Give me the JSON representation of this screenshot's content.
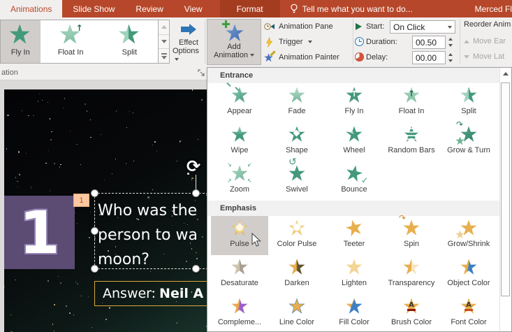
{
  "titlebar": {
    "tabs": [
      {
        "label": "Animations",
        "state": "active"
      },
      {
        "label": "Slide Show",
        "state": "normal"
      },
      {
        "label": "Review",
        "state": "normal"
      },
      {
        "label": "View",
        "state": "normal"
      },
      {
        "label": "Format",
        "state": "contextual"
      }
    ],
    "tell_me": "Tell me what you want to do...",
    "account": "Merced Fl"
  },
  "ribbon": {
    "group_label": "ation",
    "gallery_items": [
      {
        "label": "Fly In",
        "icon": "star-flyin",
        "selected": true
      },
      {
        "label": "Float In",
        "icon": "star-floatin",
        "selected": false
      },
      {
        "label": "Split",
        "icon": "star-split",
        "selected": false
      }
    ],
    "effect_options": {
      "line1": "Effect",
      "line2": "Options"
    },
    "add_animation": {
      "line1": "Add",
      "line2": "Animation"
    },
    "advanced": {
      "pane": "Animation Pane",
      "trigger": "Trigger",
      "painter": "Animation Painter"
    },
    "timing": {
      "start_label": "Start:",
      "start_value": "On Click",
      "duration_label": "Duration:",
      "duration_value": "00.50",
      "delay_label": "Delay:",
      "delay_value": "00.00"
    },
    "reorder": {
      "title": "Reorder Anim",
      "earlier": "Move Ear",
      "later": "Move Lat"
    }
  },
  "menu": {
    "sections": [
      {
        "title": "Entrance",
        "items": [
          {
            "label": "Appear",
            "icon": "star-appear"
          },
          {
            "label": "Fade",
            "icon": "star-fade"
          },
          {
            "label": "Fly In",
            "icon": "star-flyin"
          },
          {
            "label": "Float In",
            "icon": "star-floatin"
          },
          {
            "label": "Split",
            "icon": "star-split"
          },
          {
            "label": "Wipe",
            "icon": "star-wipe"
          },
          {
            "label": "Shape",
            "icon": "star-shape"
          },
          {
            "label": "Wheel",
            "icon": "star-wheel"
          },
          {
            "label": "Random Bars",
            "icon": "star-bars"
          },
          {
            "label": "Grow & Turn",
            "icon": "star-growturn"
          },
          {
            "label": "Zoom",
            "icon": "star-zoom"
          },
          {
            "label": "Swivel",
            "icon": "star-swivel"
          },
          {
            "label": "Bounce",
            "icon": "star-bounce"
          }
        ]
      },
      {
        "title": "Emphasis",
        "items": [
          {
            "label": "Pulse",
            "icon": "star-pulse",
            "highlighted": true
          },
          {
            "label": "Color Pulse",
            "icon": "star-colorpulse"
          },
          {
            "label": "Teeter",
            "icon": "star-teeter"
          },
          {
            "label": "Spin",
            "icon": "star-spin"
          },
          {
            "label": "Grow/Shrink",
            "icon": "star-growshrink"
          },
          {
            "label": "Desaturate",
            "icon": "star-desaturate"
          },
          {
            "label": "Darken",
            "icon": "star-darken"
          },
          {
            "label": "Lighten",
            "icon": "star-lighten"
          },
          {
            "label": "Transparency",
            "icon": "star-transparency"
          },
          {
            "label": "Object Color",
            "icon": "star-objectcolor"
          },
          {
            "label": "Compleme...",
            "icon": "star-complement"
          },
          {
            "label": "Line Color",
            "icon": "star-linecolor"
          },
          {
            "label": "Fill Color",
            "icon": "star-fillcolor"
          },
          {
            "label": "Brush Color",
            "icon": "star-brushcolor"
          },
          {
            "label": "Font Color",
            "icon": "star-fontcolor"
          }
        ]
      }
    ]
  },
  "slide": {
    "big_number": "1",
    "anim_badge": "1",
    "question_lines": [
      "Who was the",
      "person to wa",
      "moon?"
    ],
    "answer_label": "Answer:",
    "answer_name": "Neil A"
  },
  "colors": {
    "ribbon_accent": "#B7472A",
    "contextual_tab": "#A43C1F",
    "entrance_star": "#44997B",
    "emphasis_star": "#E8AF4E",
    "slide_accent_purple": "#5C4B73",
    "answer_border": "#D9A83C",
    "badge_bg": "#FBC8A2",
    "highlight_gray": "#D0CDCB",
    "effect_arrow_blue": "#2E75B6"
  }
}
